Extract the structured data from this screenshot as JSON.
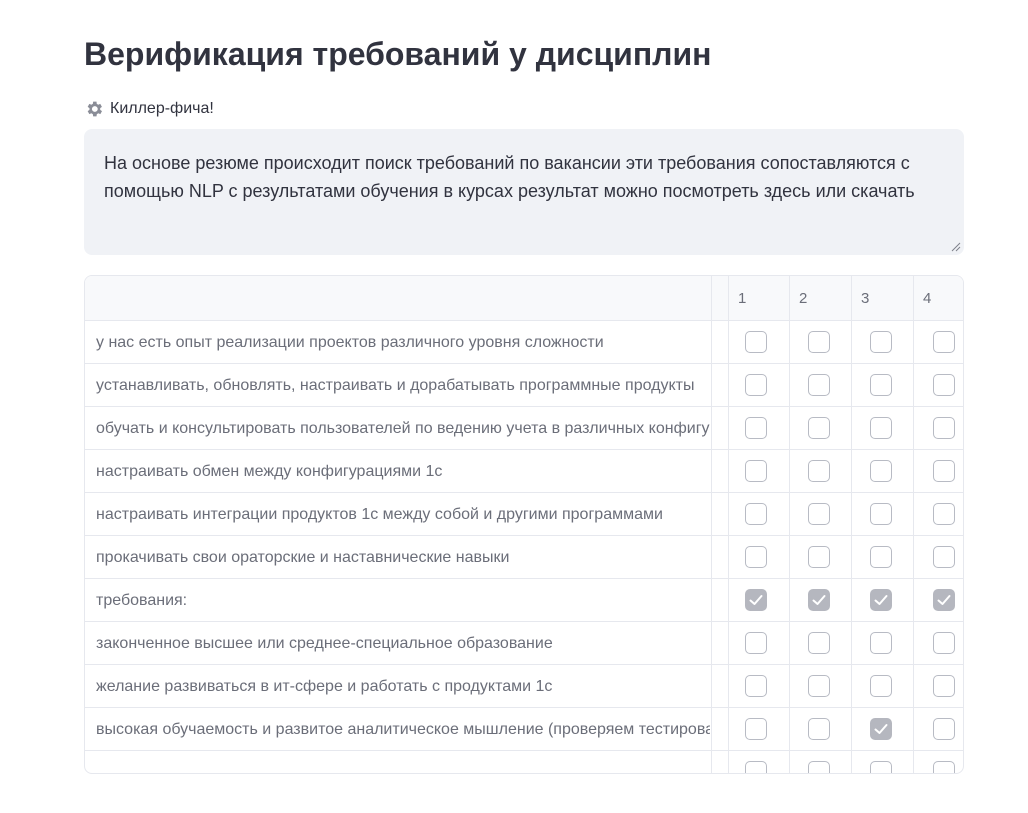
{
  "page": {
    "title": "Верификация требований у дисциплин",
    "feature_label": "Киллер-фича!",
    "feature_icon": "gear-icon",
    "description": "На основе резюме происходит поиск требований по вакансии эти требования сопоставляются с помощью NLP с результатами обучения в курсах результат можно посмотреть здесь или скачать"
  },
  "grid": {
    "columns": [
      "1",
      "2",
      "3",
      "4"
    ],
    "rows": [
      {
        "label": "у нас есть опыт реализации проектов различного уровня сложности",
        "checks": [
          false,
          false,
          false,
          false
        ]
      },
      {
        "label": "устанавливать, обновлять, настраивать и дорабатывать программные продукты",
        "checks": [
          false,
          false,
          false,
          false
        ]
      },
      {
        "label": "обучать и консультировать пользователей по ведению учета в различных конфигурациях",
        "checks": [
          false,
          false,
          false,
          false
        ]
      },
      {
        "label": "настраивать обмен между конфигурациями 1с",
        "checks": [
          false,
          false,
          false,
          false
        ]
      },
      {
        "label": "настраивать интеграции продуктов 1с между собой и другими программами",
        "checks": [
          false,
          false,
          false,
          false
        ]
      },
      {
        "label": "прокачивать свои ораторские и наставнические навыки",
        "checks": [
          false,
          false,
          false,
          false
        ]
      },
      {
        "label": "требования:",
        "checks": [
          true,
          true,
          true,
          true
        ]
      },
      {
        "label": "законченное высшее или среднее-специальное образование",
        "checks": [
          false,
          false,
          false,
          false
        ]
      },
      {
        "label": "желание развиваться в ит-сфере и работать с продуктами 1с",
        "checks": [
          false,
          false,
          false,
          false
        ]
      },
      {
        "label": "высокая обучаемость и развитое аналитическое мышление (проверяем тестированием)",
        "checks": [
          false,
          false,
          true,
          false
        ]
      },
      {
        "label": "",
        "checks": [
          false,
          false,
          false,
          false
        ]
      }
    ]
  },
  "colors": {
    "text": "#31333f",
    "muted": "#6b6e79",
    "textarea_bg": "#f0f2f6",
    "border": "#e6e8ee",
    "checked": "#b5b7bf"
  }
}
